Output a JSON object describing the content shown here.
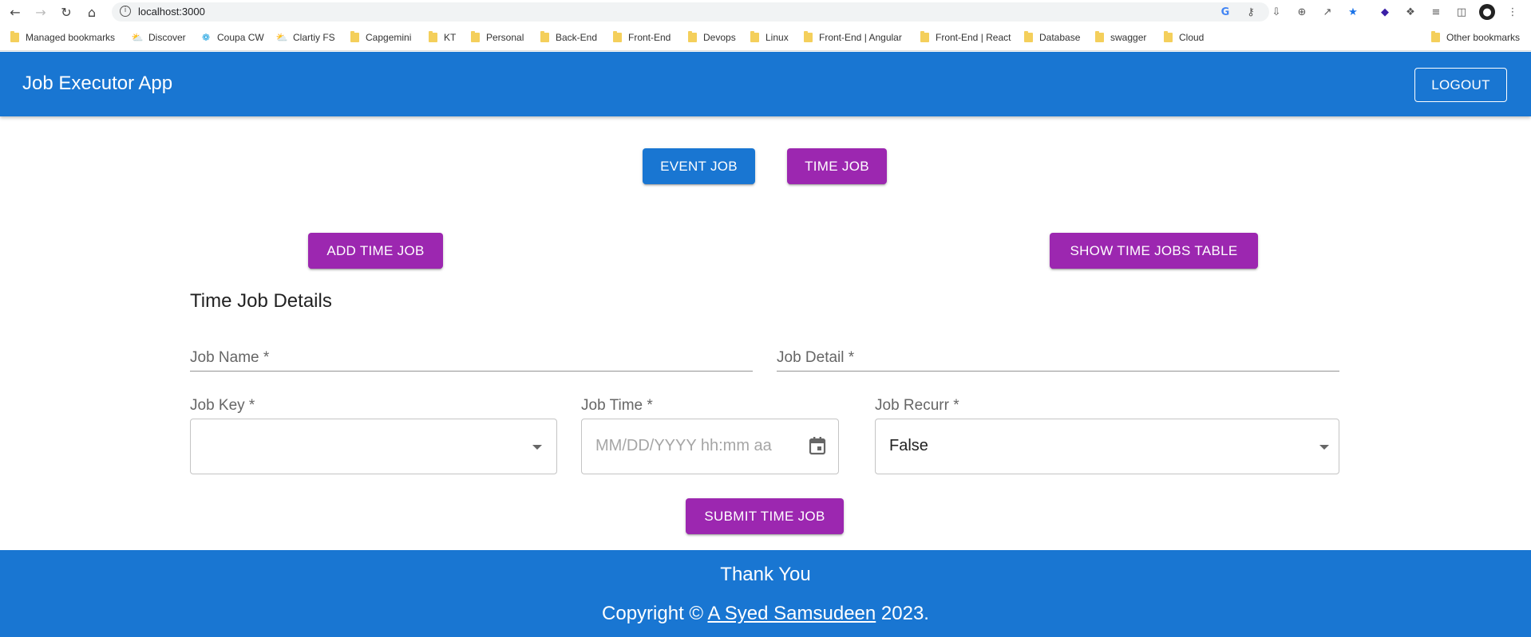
{
  "browser": {
    "url": "localhost:3000",
    "bookmarks": [
      {
        "label": "Managed bookmarks",
        "icon": "folder-icon"
      },
      {
        "label": "Discover",
        "icon": "discover-icon"
      },
      {
        "label": "Coupa CW",
        "icon": "coupa-icon"
      },
      {
        "label": "Clartiy FS",
        "icon": "discover-icon"
      },
      {
        "label": "Capgemini",
        "icon": "folder-icon"
      },
      {
        "label": "KT",
        "icon": "folder-icon"
      },
      {
        "label": "Personal",
        "icon": "folder-icon"
      },
      {
        "label": "Back-End",
        "icon": "folder-icon"
      },
      {
        "label": "Front-End",
        "icon": "folder-icon"
      },
      {
        "label": "Devops",
        "icon": "folder-icon"
      },
      {
        "label": "Linux",
        "icon": "folder-icon"
      },
      {
        "label": "Front-End | Angular",
        "icon": "folder-icon"
      },
      {
        "label": "Front-End | React",
        "icon": "folder-icon"
      },
      {
        "label": "Database",
        "icon": "folder-icon"
      },
      {
        "label": "swagger",
        "icon": "folder-icon"
      },
      {
        "label": "Cloud",
        "icon": "folder-icon"
      }
    ],
    "other_bookmarks": "Other bookmarks"
  },
  "appbar": {
    "title": "Job Executor App",
    "logout_label": "LOGOUT"
  },
  "toggle": {
    "event_job_label": "EVENT JOB",
    "time_job_label": "TIME JOB"
  },
  "actions": {
    "add_time_job_label": "ADD TIME JOB",
    "show_table_label": "SHOW TIME JOBS TABLE"
  },
  "form": {
    "title": "Time Job Details",
    "job_name_label": "Job Name *",
    "job_detail_label": "Job Detail *",
    "job_key_label": "Job Key *",
    "job_key_value": "",
    "job_time_label": "Job Time *",
    "job_time_placeholder": "MM/DD/YYYY hh:mm aa",
    "job_recurr_label": "Job Recurr *",
    "job_recurr_value": "False",
    "submit_label": "SUBMIT TIME JOB"
  },
  "footer": {
    "thanks": "Thank You",
    "copyright_prefix": "Copyright © ",
    "author": "A Syed Samsudeen",
    "copyright_suffix": " 2023."
  },
  "colors": {
    "primary": "#1976d2",
    "secondary": "#9c27b0"
  }
}
